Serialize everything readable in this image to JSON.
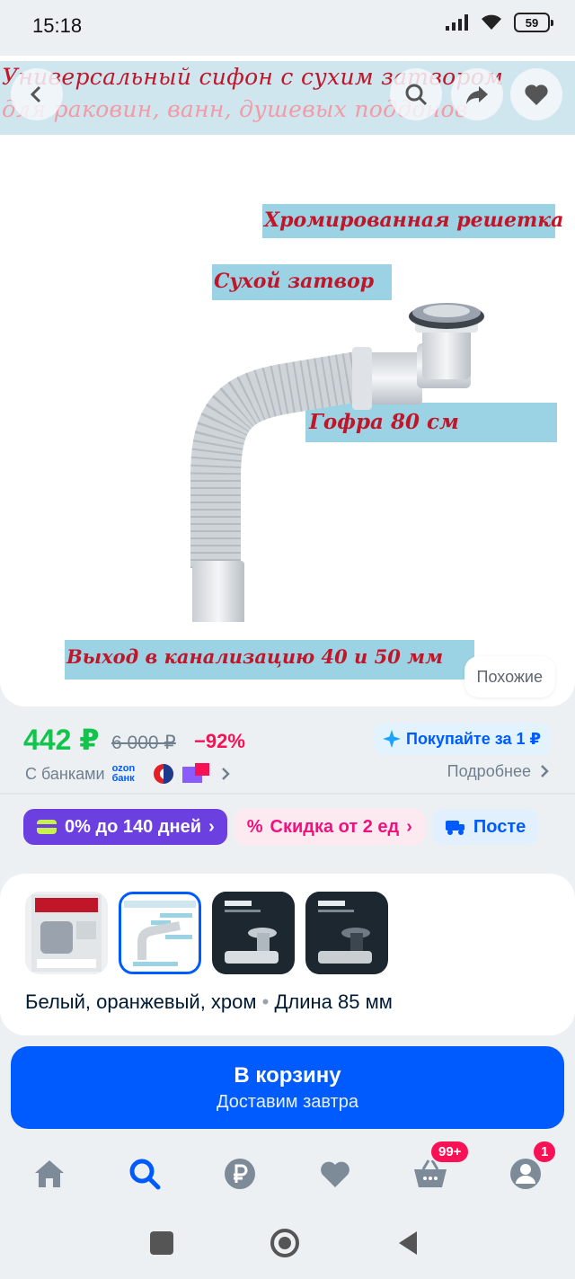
{
  "status": {
    "time": "15:18",
    "battery": "59"
  },
  "image": {
    "title_line1": "Универсальный сифон с сухим затвором",
    "title_line2": "для раковин, ванн, душевых поддонов",
    "labels": {
      "grate": "Хромированная решетка",
      "dry_lock": "Сухой затвор",
      "corrugation": "Гофра 80 см",
      "outlet": "Выход в канализацию 40 и 50 мм"
    },
    "similar": "Похожие"
  },
  "price": {
    "current": "442 ₽",
    "old": "6 000 ₽",
    "discount": "−92%",
    "buy_for": "Покупайте за 1 ₽",
    "banks": "С банками",
    "ozon_bank": "ozon банк",
    "more": "Подробнее"
  },
  "chips": {
    "installments": "0% до 140 дней",
    "discount": "Скидка от 2 ед",
    "delivery": "Посте"
  },
  "variants": {
    "thumbs": [
      "Сифон для раковины с сухим затвором",
      "Универсальный сифон",
      "Сифон",
      "Сифон"
    ],
    "description_color": "Белый, оранжевый, хром",
    "description_length": "Длина 85 мм"
  },
  "cart": {
    "label": "В корзину",
    "sub": "Доставим завтра"
  },
  "bottom_nav": {
    "cart_badge": "99+",
    "profile_badge": "1"
  },
  "colors": {
    "accent": "#005bff",
    "price": "#10c44c",
    "discount": "#f91155"
  }
}
